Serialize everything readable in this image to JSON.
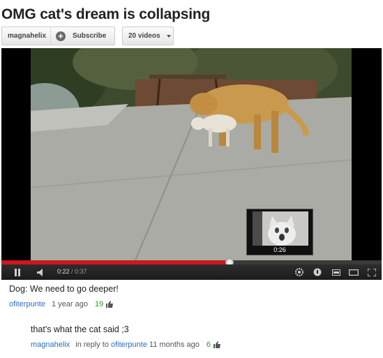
{
  "video": {
    "title": "OMG cat's dream is collapsing",
    "channel": "magnahelix",
    "subscribe_label": "Subscribe",
    "videos_label": "20 videos"
  },
  "player": {
    "current_time": "0:22",
    "duration": "/ 0:37",
    "preview_time": "0:26",
    "progress_fraction": 0.6,
    "accent_color": "#cc181e"
  },
  "comments": [
    {
      "text": "Dog: We need to go deeper!",
      "author": "ofiterpunte",
      "time": "1 year ago",
      "likes": "19"
    },
    {
      "text": "that's what the cat said ;3",
      "author": "magnahelix",
      "reply_prefix": "in reply to",
      "reply_to": "ofiterpunte",
      "time": "11 months ago",
      "likes": "6"
    }
  ]
}
